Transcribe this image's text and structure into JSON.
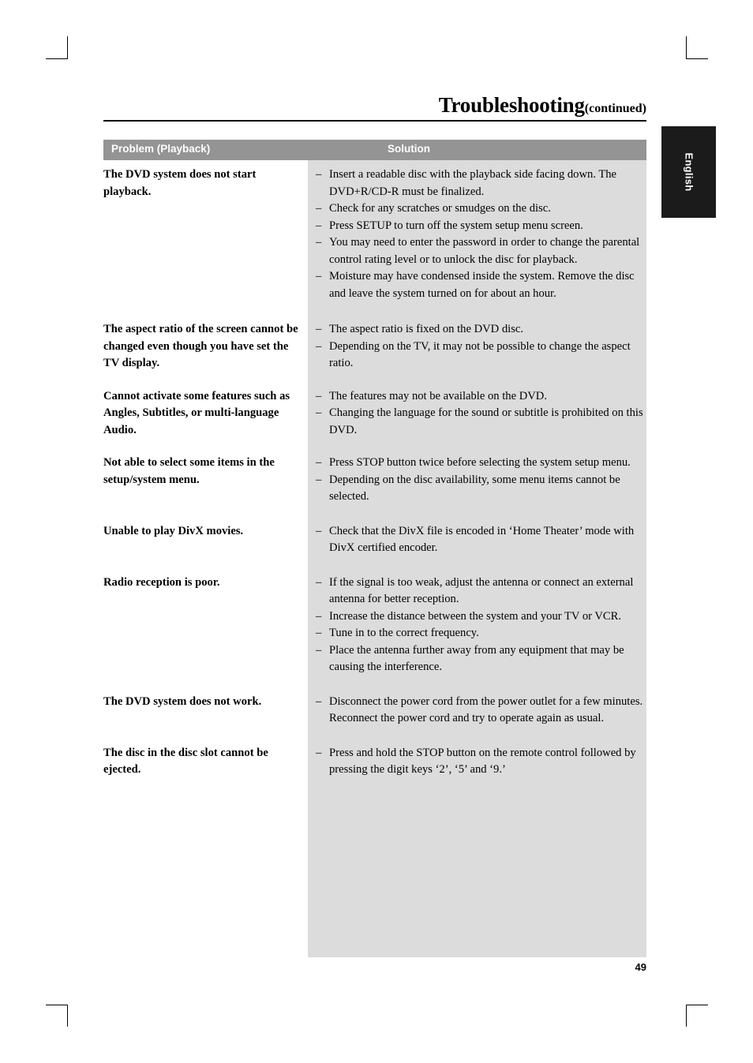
{
  "header": {
    "title": "Troubleshooting",
    "title_suffix": "(continued)",
    "language_tab": "English"
  },
  "table": {
    "columns": {
      "problem": "Problem (Playback)",
      "solution": "Solution"
    },
    "rows": [
      {
        "problem": "The DVD system does not start playback.",
        "solutions": [
          "Insert a readable disc with the playback side facing down. The DVD+R/CD-R must be finalized.",
          "Check for any scratches or smudges on the disc.",
          "Press SETUP to turn off the system setup menu screen.",
          "You may need to enter the password in order to change the parental control rating level or to unlock the disc for playback.",
          "Moisture may have condensed inside the system. Remove the disc and leave the system turned on for about an hour."
        ]
      },
      {
        "problem": "The aspect ratio of the screen cannot be changed even though you have set the TV display.",
        "solutions": [
          "The aspect ratio is fixed on the DVD disc.",
          "Depending on the TV, it may not be possible to change the aspect ratio."
        ]
      },
      {
        "problem": "Cannot activate some features such as Angles, Subtitles, or multi-language Audio.",
        "solutions": [
          "The features may not be available on the DVD.",
          "Changing the language for the sound or subtitle is prohibited on this DVD."
        ]
      },
      {
        "problem": "Not able to select some items in the setup/system menu.",
        "solutions": [
          "Press STOP button twice before selecting the system setup menu.",
          "Depending on the disc availability, some menu items cannot be selected."
        ]
      },
      {
        "problem": "Unable to play DivX movies.",
        "solutions": [
          "Check that the DivX file is encoded in ‘Home Theater’ mode with DivX certified encoder."
        ]
      },
      {
        "problem": "Radio reception is poor.",
        "solutions": [
          "If the signal is too weak, adjust the antenna or connect an external antenna for better reception.",
          "Increase the distance between the system and your TV or VCR.",
          "Tune in to the correct frequency.",
          "Place the antenna further away from any equipment that may be causing the interference."
        ]
      },
      {
        "problem": "The DVD system does not work.",
        "solutions": [
          "Disconnect the power cord from the power outlet for a few minutes. Reconnect the power cord and try to operate again as usual."
        ]
      },
      {
        "problem": "The disc in the disc slot cannot be ejected.",
        "solutions": [
          "Press and hold the STOP button on the remote control followed by pressing the digit keys ‘2’, ‘5’ and ‘9.’"
        ]
      }
    ]
  },
  "footer": {
    "page_number": "49"
  },
  "symbols": {
    "dash": "–"
  },
  "colors": {
    "header_band": "#949494",
    "solution_column": "#dcdcdc",
    "tab": "#1b1b1b"
  }
}
